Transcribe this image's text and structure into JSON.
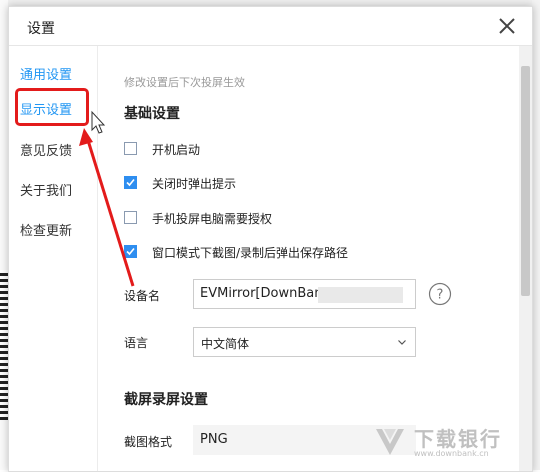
{
  "dialog": {
    "title": "设置",
    "close_icon": "close-icon"
  },
  "sidebar": {
    "items": [
      {
        "label": "通用设置"
      },
      {
        "label": "显示设置"
      },
      {
        "label": "意见反馈"
      },
      {
        "label": "关于我们"
      },
      {
        "label": "检查更新"
      }
    ]
  },
  "content": {
    "hint": "修改设置后下次投屏生效",
    "basic_section": "基础设置",
    "checkboxes": [
      {
        "label": "开机启动",
        "checked": false
      },
      {
        "label": "关闭时弹出提示",
        "checked": true
      },
      {
        "label": "手机投屏电脑需要授权",
        "checked": false
      },
      {
        "label": "窗口模式下截图/录制后弹出保存路径",
        "checked": true
      }
    ],
    "device_name_label": "设备名",
    "device_name_value": "EVMirror[DownBank",
    "language_label": "语言",
    "language_value": "中文简体",
    "capture_section": "截屏录屏设置",
    "screenshot_format_label": "截图格式",
    "screenshot_format_value": "PNG"
  },
  "watermark": {
    "text": "下载银行",
    "sub": "www.downbank.cn"
  },
  "colors": {
    "accent": "#2196f3",
    "annotation_red": "#e31b1b"
  }
}
